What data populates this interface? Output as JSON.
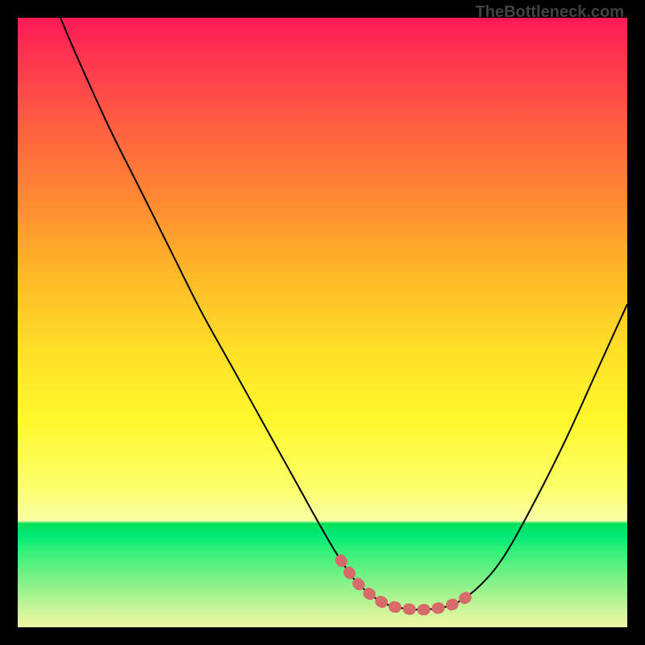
{
  "attribution": "TheBottleneck.com",
  "chart_data": {
    "type": "line",
    "title": "",
    "xlabel": "",
    "ylabel": "",
    "xlim": [
      0,
      100
    ],
    "ylim": [
      0,
      100
    ],
    "series": [
      {
        "name": "bottleneck-curve",
        "x": [
          7,
          10,
          15,
          20,
          25,
          30,
          35,
          40,
          45,
          50,
          53,
          56,
          60,
          64,
          68,
          72,
          76,
          80,
          85,
          90,
          95,
          100
        ],
        "values": [
          100,
          93,
          82,
          72,
          62,
          52,
          43,
          34,
          25,
          16,
          11,
          7,
          4,
          3,
          3,
          4,
          7,
          12,
          21,
          31,
          42,
          53
        ]
      }
    ],
    "highlight": {
      "name": "optimal-range",
      "x": [
        53,
        56,
        60,
        64,
        68,
        72,
        75
      ],
      "values": [
        11,
        7,
        4,
        3,
        3,
        4,
        6
      ]
    }
  },
  "colors": {
    "curve": "#000000",
    "highlight": "#d86a6a",
    "bg_top": "#ff1a58",
    "bg_bottom": "#00e05a",
    "frame": "#000000"
  }
}
